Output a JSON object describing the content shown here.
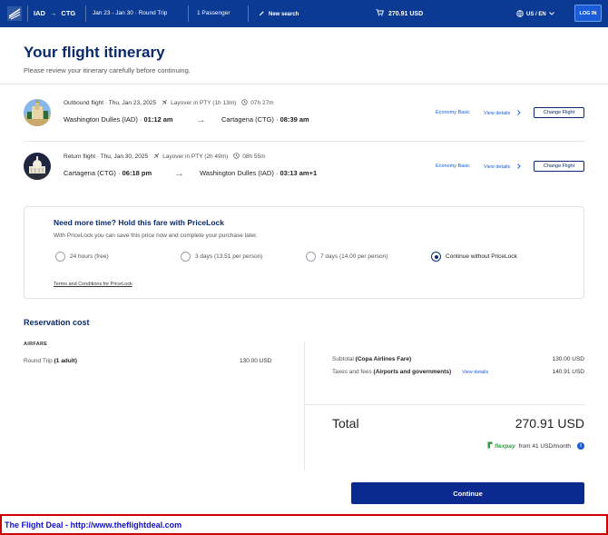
{
  "header": {
    "route_from": "IAD",
    "route_to": "CTG",
    "dates": "Jan 23 - Jan 30 · Round Trip",
    "passengers": "1 Passenger",
    "new_search": "New search",
    "cart_total": "270.91 USD",
    "locale": "US / EN",
    "login": "LOG IN",
    "colors": {
      "bar": "#0a3a93",
      "accent": "#1a5cd8"
    }
  },
  "page": {
    "title": "Your flight itinerary",
    "subtitle": "Please review your itinerary carefully before continuing."
  },
  "flights": [
    {
      "label": "Outbound flight · Thu, Jan 23, 2025",
      "layover": "Layover in PTY (1h 13m)",
      "duration": "07h 27m",
      "origin": "Washington Dulles (IAD) · ",
      "origin_time": "01:12 am",
      "destination": "Cartagena (CTG) · ",
      "destination_time": "08:39 am",
      "cabin": "Economy Basic",
      "view_details": "View details",
      "change": "Change Flight"
    },
    {
      "label": "Return flight · Thu, Jan 30, 2025",
      "layover": "Layover in PTY (2h 49m)",
      "duration": "08h 55m",
      "origin": "Cartagena (CTG) · ",
      "origin_time": "06:18 pm",
      "destination": "Washington Dulles (IAD) · ",
      "destination_time": "03:13 am+1",
      "cabin": "Economy Basic",
      "view_details": "View details",
      "change": "Change Flight"
    }
  ],
  "pricelock": {
    "title": "Need more time? Hold this fare with PriceLock",
    "subtitle": "With PriceLock you can save this price now and complete your purchase later.",
    "options": [
      {
        "label": "24 hours (free)",
        "selected": false
      },
      {
        "label": "3 days (13.51 per person)",
        "selected": false
      },
      {
        "label": "7 days (14.00 per person)",
        "selected": false
      },
      {
        "label": "Continue without PriceLock",
        "selected": true
      }
    ],
    "terms": "Terms and Conditions for PriceLock"
  },
  "reservation": {
    "title": "Reservation cost",
    "airfare_label": "AIRFARE",
    "round_trip": "Round Trip",
    "round_trip_pax": "(1 adult)",
    "round_trip_value": "130.00 USD",
    "subtotal_label": "Subtotal",
    "subtotal_note": "(Copa Airlines Fare)",
    "subtotal_value": "130.00 USD",
    "taxes_label": "Taxes and fees",
    "taxes_note": "(Airports and governments)",
    "taxes_link": "View details",
    "taxes_value": "140.91 USD",
    "total_label": "Total",
    "total_value": "270.91 USD",
    "flexpay_brand": "flexpay",
    "flexpay_text": "from 41 USD/month",
    "continue": "Continue"
  },
  "footer": {
    "ad_text": "The Flight Deal - http://www.theflightdeal.com"
  }
}
